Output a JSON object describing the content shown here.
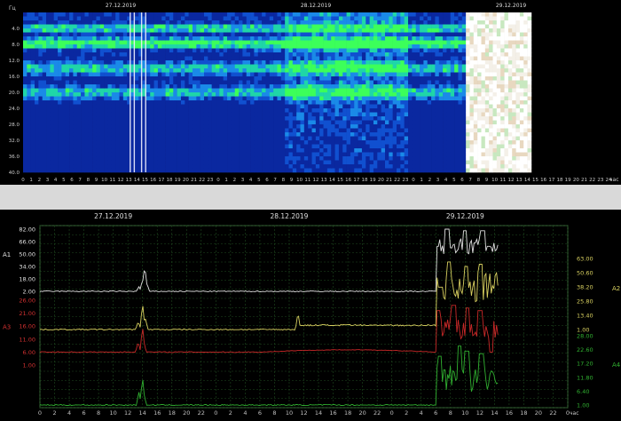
{
  "chart_data": [
    {
      "type": "heatmap",
      "title": "",
      "y_unit_label": "Гц",
      "x_unit_label": "час",
      "dates": [
        "27.12.2019",
        "28.12.2019",
        "29.12.2019"
      ],
      "y_ticks": [
        "4.0",
        "8.0",
        "12.0",
        "16.0",
        "20.0",
        "24.0",
        "28.0",
        "32.0",
        "36.0",
        "40.0"
      ],
      "ylim": [
        0,
        40
      ],
      "x_ticks": [
        "0",
        "1",
        "2",
        "3",
        "4",
        "5",
        "6",
        "7",
        "8",
        "9",
        "10",
        "11",
        "12",
        "13",
        "14",
        "15",
        "16",
        "17",
        "18",
        "19",
        "20",
        "21",
        "22",
        "23",
        "0",
        "1",
        "2",
        "3",
        "4",
        "5",
        "6",
        "7",
        "8",
        "9",
        "10",
        "11",
        "12",
        "13",
        "14",
        "15",
        "16",
        "17",
        "18",
        "19",
        "20",
        "21",
        "22",
        "23",
        "0",
        "1",
        "2",
        "3",
        "4",
        "5",
        "6",
        "7",
        "8",
        "9",
        "10",
        "11",
        "12",
        "13",
        "14",
        "15",
        "16",
        "17",
        "18",
        "19",
        "20",
        "21",
        "22",
        "23",
        "24"
      ],
      "xlim_hours": [
        0,
        72
      ],
      "data_end_hour": 62.5,
      "saturated_from_hour": 54,
      "bands_hz": [
        4.0,
        7.8,
        14.0,
        20.0
      ],
      "colors": {
        "background": "#061a8c",
        "high": "#23ff3a",
        "saturated": "#ffffff"
      }
    },
    {
      "type": "line",
      "title": "",
      "x_unit_label": "час",
      "dates": [
        "27.12.2019",
        "28.12.2019",
        "29.12.2019"
      ],
      "x_ticks": [
        "0",
        "2",
        "4",
        "6",
        "8",
        "10",
        "12",
        "14",
        "16",
        "18",
        "20",
        "22",
        "0",
        "2",
        "4",
        "6",
        "8",
        "10",
        "12",
        "14",
        "16",
        "18",
        "20",
        "22",
        "0",
        "2",
        "4",
        "6",
        "8",
        "10",
        "12",
        "14",
        "16",
        "18",
        "20",
        "22",
        "0"
      ],
      "xlim_hours": [
        0,
        72
      ],
      "series": [
        {
          "name": "A1",
          "color": "#e0e0e0",
          "ticks": [
            "82.00",
            "66.00",
            "50.00",
            "34.00",
            "18.00",
            "2.00"
          ],
          "tick_color": "#e0e0e0",
          "axis_side": "left",
          "baseline": 2.0,
          "peaks": [
            [
              13.5,
              8
            ],
            [
              14.0,
              18
            ],
            [
              14.3,
              36
            ],
            [
              14.6,
              12
            ]
          ],
          "active_level": [
            50,
            78
          ],
          "spikes": [
            [
              54.2,
              60
            ],
            [
              55.5,
              82
            ],
            [
              58,
              80
            ],
            [
              60.4,
              80
            ],
            [
              61.2,
              60
            ]
          ]
        },
        {
          "name": "A2",
          "color": "#d8d060",
          "ticks": [
            "63.00",
            "50.60",
            "38.20",
            "25.80",
            "13.40",
            "1.00"
          ],
          "tick_color": "#d8d060",
          "axis_side": "right",
          "baseline": 1.0,
          "peaks": [
            [
              13.4,
              8
            ],
            [
              14.0,
              24
            ],
            [
              14.4,
              10
            ],
            [
              35.2,
              16
            ]
          ],
          "active_level": [
            25,
            60
          ],
          "spikes": [
            [
              54.6,
              38
            ],
            [
              55.8,
              60
            ],
            [
              58.1,
              56
            ],
            [
              60.1,
              58
            ]
          ]
        },
        {
          "name": "A3",
          "color": "#c82828",
          "ticks": [
            "26.00",
            "21.00",
            "16.00",
            "11.00",
            "6.00",
            "1.00"
          ],
          "tick_color": "#d03030",
          "axis_side": "left",
          "baseline": 6.0,
          "peaks": [
            [
              13.4,
              10
            ],
            [
              14.0,
              16
            ],
            [
              14.2,
              9
            ]
          ],
          "active_level": [
            11,
            22
          ],
          "spikes": [
            [
              54.3,
              22
            ],
            [
              56.4,
              24
            ],
            [
              58.3,
              23
            ],
            [
              60.0,
              22
            ]
          ]
        },
        {
          "name": "A4",
          "color": "#30b030",
          "ticks": [
            "28.00",
            "22.60",
            "17.20",
            "11.80",
            "6.40",
            "1.00"
          ],
          "tick_color": "#30b030",
          "axis_side": "right",
          "baseline": 1.0,
          "peaks": [
            [
              13.5,
              6
            ],
            [
              14.0,
              12
            ],
            [
              14.2,
              5
            ]
          ],
          "active_level": [
            6,
            20
          ],
          "spikes": [
            [
              54.5,
              20
            ],
            [
              57.2,
              24
            ],
            [
              58.2,
              22
            ],
            [
              60.2,
              21
            ]
          ]
        }
      ]
    }
  ]
}
